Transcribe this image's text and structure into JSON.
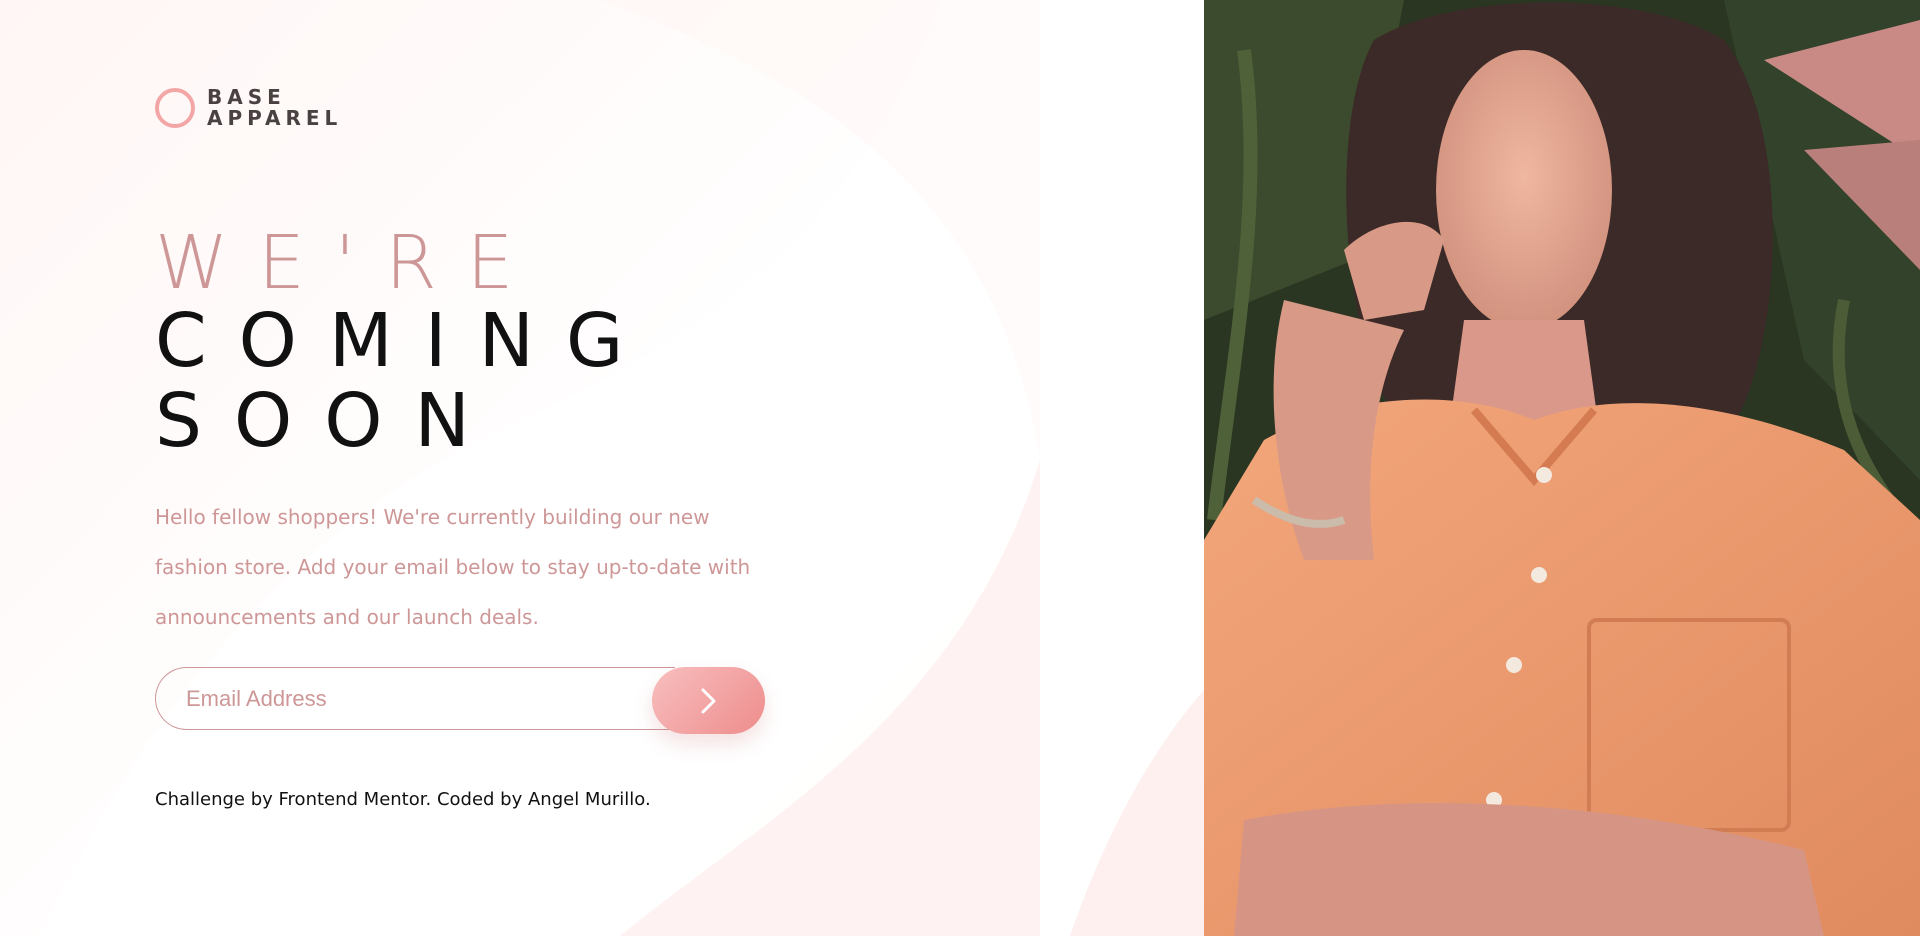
{
  "brand": {
    "line1": "BASE",
    "line2": "APPAREL"
  },
  "headline": {
    "line1": "WE'RE",
    "line2": "COMING",
    "line3": "SOON"
  },
  "description": "Hello fellow shoppers! We're currently building our new fashion store. Add your email below to stay up-to-date with announcements and our launch deals.",
  "form": {
    "email_placeholder": "Email Address",
    "submit_icon": "chevron-right-icon"
  },
  "footer": {
    "attribution": "Challenge by Frontend Mentor. Coded by Angel Murillo."
  },
  "hero": {
    "image_description": "woman-in-orange-shirt-photo"
  },
  "colors": {
    "accent": "#ce9797",
    "button_gradient_start": "#f8bfbf",
    "button_gradient_end": "#ee8c8c",
    "text_dark": "#111111"
  }
}
